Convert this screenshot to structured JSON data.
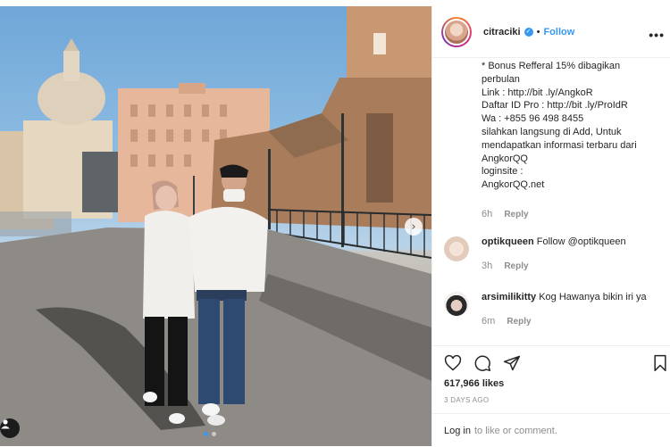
{
  "post": {
    "username": "citraciki",
    "verified_mark": "✓",
    "separator": "•",
    "follow_label": "Follow",
    "more_icon": "•••",
    "caption_lines": [
      "* Bonus Refferal 15% dibagikan",
      "perbulan",
      "Link : http://bit .ly/AngkoR",
      "Daftar ID Pro : http://bit .ly/ProIdR",
      "Wa : +855 96 498 8455",
      "silahkan langsung di Add, Untuk",
      "mendapatkan informasi terbaru dari",
      "AngkorQQ",
      "loginsite :",
      "AngkorQQ.net"
    ],
    "caption_time": "6h",
    "reply_label": "Reply"
  },
  "comments": [
    {
      "user": "optikqueen",
      "text": "Follow @optikqueen",
      "time": "3h",
      "reply": "Reply"
    },
    {
      "user": "arsimilikitty",
      "text": "Kog Hawanya bikin iri ya",
      "time": "6m",
      "reply": "Reply"
    }
  ],
  "actions": {
    "like_icon": "heart-icon",
    "comment_icon": "comment-icon",
    "share_icon": "share-icon",
    "save_icon": "bookmark-icon",
    "likes": "617,966 likes",
    "posted": "3 DAYS AGO"
  },
  "footer": {
    "login_link": "Log in",
    "login_suffix": "to like or comment."
  },
  "carousel": {
    "next_arrow": "›"
  },
  "colors": {
    "accent": "#3897f0",
    "text": "#262626",
    "muted": "#8e8e8e"
  }
}
